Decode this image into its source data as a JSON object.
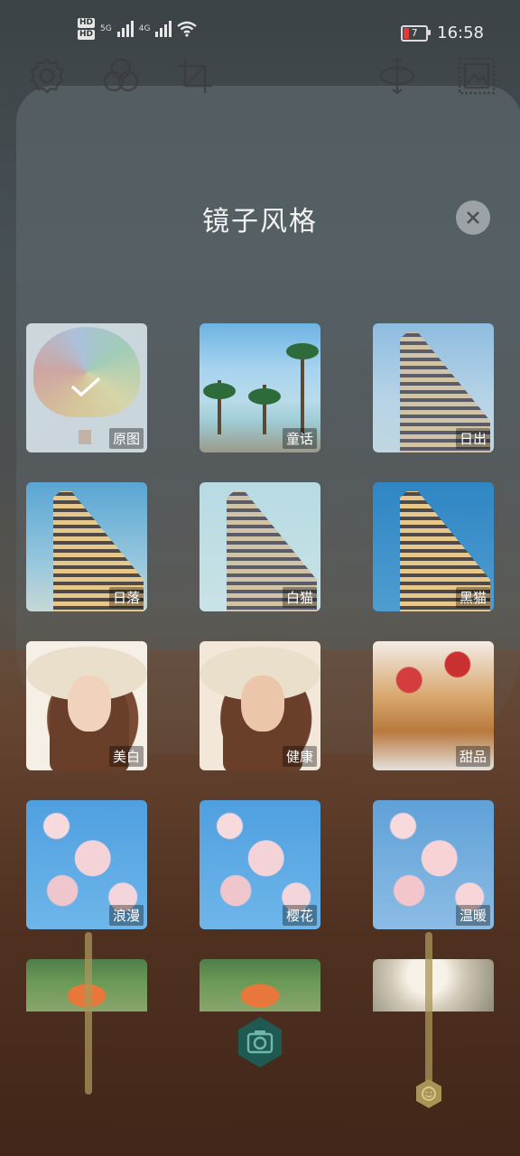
{
  "status_bar": {
    "hd1": "HD",
    "hd2": "HD",
    "sim1_label": "5G",
    "sim2_label": "4G",
    "battery_level": "7",
    "time": "16:58"
  },
  "toolbar": {
    "icons": [
      "gear-icon",
      "circles-icon",
      "crop-icon",
      "rotate-icon",
      "gallery-icon"
    ]
  },
  "panel": {
    "title": "镜子风格"
  },
  "styles": [
    {
      "label": "原图",
      "selected": true
    },
    {
      "label": "童话",
      "selected": false
    },
    {
      "label": "日出",
      "selected": false
    },
    {
      "label": "日落",
      "selected": false
    },
    {
      "label": "白猫",
      "selected": false
    },
    {
      "label": "黑猫",
      "selected": false
    },
    {
      "label": "美白",
      "selected": false
    },
    {
      "label": "健康",
      "selected": false
    },
    {
      "label": "甜品",
      "selected": false
    },
    {
      "label": "浪漫",
      "selected": false
    },
    {
      "label": "樱花",
      "selected": false
    },
    {
      "label": "温暖",
      "selected": false
    }
  ],
  "colors": {
    "shutter": "#1e5a52",
    "slider": "#a89455"
  }
}
